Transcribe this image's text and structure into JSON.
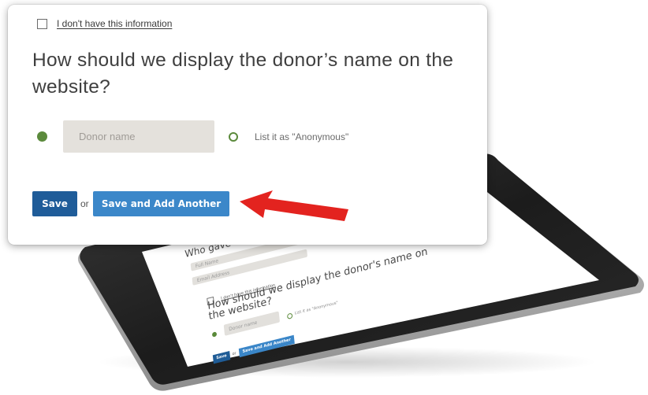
{
  "form": {
    "no_info_checkbox_label": "I don't have this information",
    "question": "How should we display the donor’s name on the website?",
    "donor_name_placeholder": "Donor name",
    "anonymous_option_label": "List it as \"Anonymous\"",
    "save_label": "Save",
    "or_text": "or",
    "save_and_add_label": "Save and Add Another"
  },
  "tablet_screen": {
    "question_1": "Who gave this",
    "field_1_placeholder": "Full Name",
    "field_2_placeholder": "Email Address",
    "no_info_checkbox_label": "I don't have this information",
    "question_2": "How should we display the donor's name on the website?",
    "donor_name_placeholder": "Donor name",
    "anonymous_option_label": "List it as \"Anonymous\"",
    "save_label": "Save",
    "or_text": "or",
    "save_and_add_label": "Save and Add Another"
  },
  "colors": {
    "save_button": "#1f5c99",
    "save_and_add_button": "#3b87c9",
    "radio_green": "#5b8a3c",
    "input_background": "#e4e1dc",
    "arrow_red": "#e3231f"
  },
  "icons": {
    "arrow": "red-arrow-pointing-left",
    "radio_selected": "filled-circle",
    "radio_unselected": "hollow-circle",
    "checkbox": "empty-square"
  }
}
